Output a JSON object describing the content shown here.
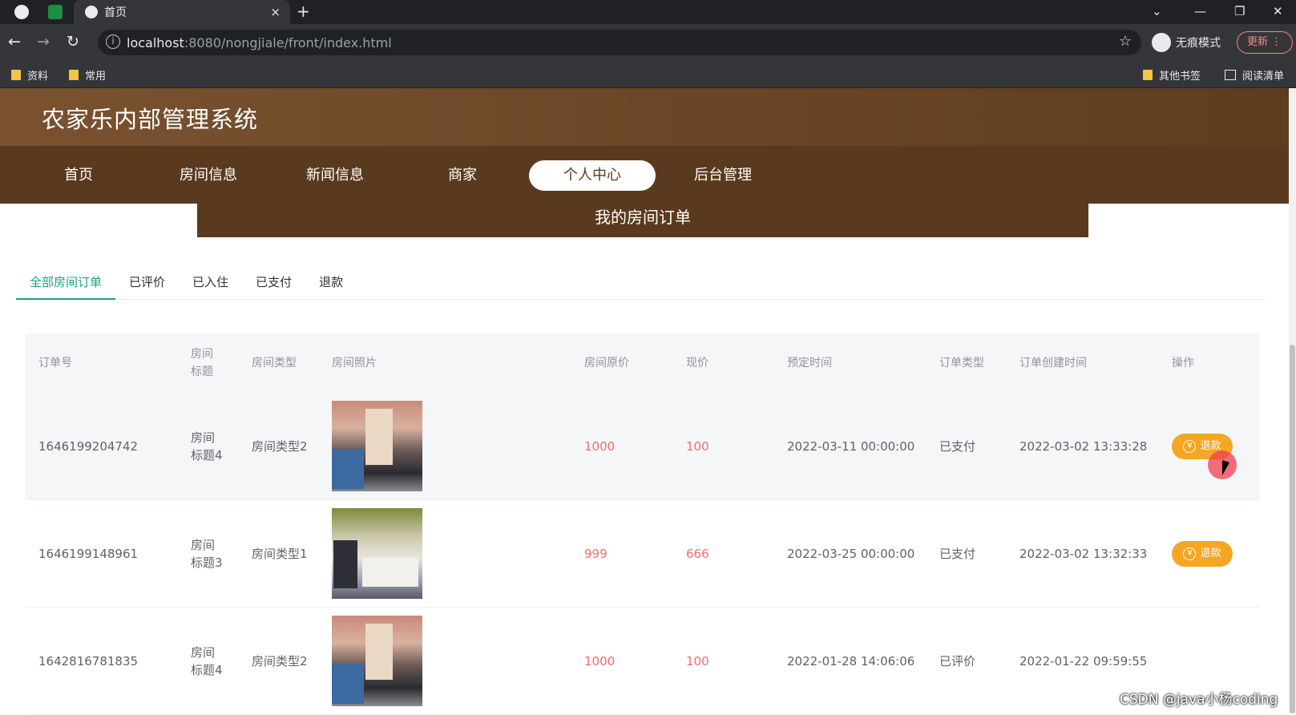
{
  "browser": {
    "tab_title": "首页",
    "new_tab": "+",
    "close_tab": "×",
    "url_host": "localhost",
    "url_path": ":8080/nongjiale/front/index.html",
    "incognito_label": "无痕模式",
    "update_label": "更新",
    "bookmarks": [
      "资料",
      "常用"
    ],
    "bookmarks_right": [
      "其他书签",
      "阅读清单"
    ]
  },
  "site": {
    "title": "农家乐内部管理系统",
    "nav": [
      "首页",
      "房间信息",
      "新闻信息",
      "商家",
      "个人中心",
      "后台管理"
    ],
    "active_nav": "个人中心",
    "banner": "我的房间订单",
    "tabs": [
      "全部房间订单",
      "已评价",
      "已入住",
      "已支付",
      "退款"
    ],
    "active_tab": "全部房间订单"
  },
  "table": {
    "headers": [
      "订单号",
      "房间标题",
      "房间类型",
      "房间照片",
      "房间原价",
      "现价",
      "预定时间",
      "订单类型",
      "订单创建时间",
      "操作"
    ],
    "rows": [
      {
        "order_no": "1646199204742",
        "room_title": "房间标题4",
        "room_type": "房间类型2",
        "original_price": "1000",
        "price": "100",
        "book_time": "2022-03-11 00:00:00",
        "order_type": "已支付",
        "created": "2022-03-02 13:33:28",
        "action": "退款"
      },
      {
        "order_no": "1646199148961",
        "room_title": "房间标题3",
        "room_type": "房间类型1",
        "original_price": "999",
        "price": "666",
        "book_time": "2022-03-25 00:00:00",
        "order_type": "已支付",
        "created": "2022-03-02 13:32:33",
        "action": "退款"
      },
      {
        "order_no": "1642816781835",
        "room_title": "房间标题4",
        "room_type": "房间类型2",
        "original_price": "1000",
        "price": "100",
        "book_time": "2022-01-28 14:06:06",
        "order_type": "已评价",
        "created": "2022-01-22 09:59:55",
        "action": ""
      }
    ]
  },
  "watermark": "CSDN @java小杨coding",
  "colors": {
    "brand_brown": "#5a3a1e",
    "accent_green": "#1aa08a",
    "price_red": "#f56c6c",
    "refund_orange": "#f5a623"
  }
}
